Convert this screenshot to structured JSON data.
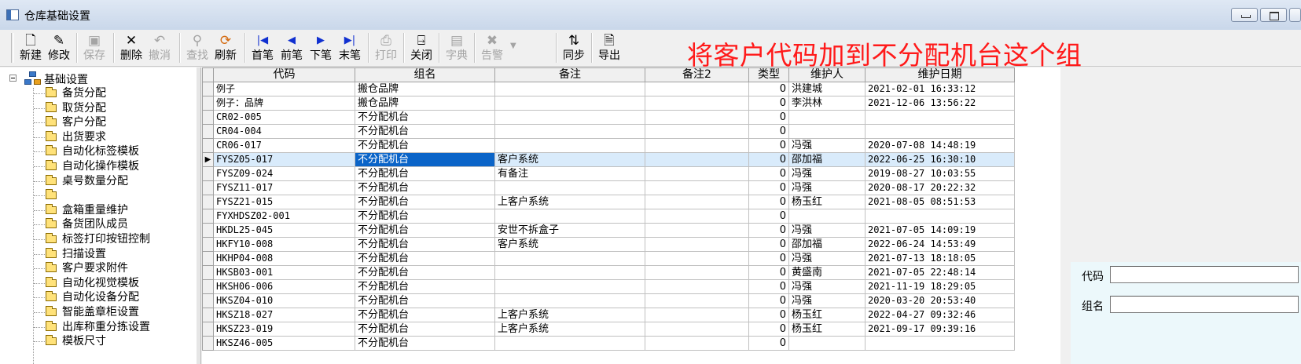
{
  "window": {
    "title": "仓库基础设置"
  },
  "toolbar": {
    "buttons": [
      {
        "label": "新建",
        "icon": "new-document-icon",
        "enabled": true
      },
      {
        "label": "修改",
        "icon": "edit-icon",
        "enabled": true
      },
      {
        "label": "保存",
        "icon": "save-disk-icon",
        "enabled": false
      },
      {
        "label": "删除",
        "icon": "delete-x-icon",
        "enabled": true
      },
      {
        "label": "撤消",
        "icon": "undo-icon",
        "enabled": false
      },
      {
        "label": "查找",
        "icon": "binoculars-icon",
        "enabled": false
      },
      {
        "label": "刷新",
        "icon": "refresh-icon",
        "enabled": true
      },
      {
        "label": "首笔",
        "icon": "first-record-icon",
        "enabled": true
      },
      {
        "label": "前笔",
        "icon": "previous-record-icon",
        "enabled": true
      },
      {
        "label": "下笔",
        "icon": "next-record-icon",
        "enabled": true
      },
      {
        "label": "末笔",
        "icon": "last-record-icon",
        "enabled": true
      },
      {
        "label": "打印",
        "icon": "printer-icon",
        "enabled": false
      },
      {
        "label": "关闭",
        "icon": "close-door-icon",
        "enabled": true
      },
      {
        "label": "字典",
        "icon": "dictionary-icon",
        "enabled": false
      },
      {
        "label": "告警",
        "icon": "alarm-icon",
        "enabled": false
      },
      {
        "label": "同步",
        "icon": "sync-icon",
        "enabled": true
      },
      {
        "label": "导出",
        "icon": "export-icon",
        "enabled": true
      }
    ]
  },
  "annotation": "将客户代码加到不分配机台这个组",
  "tree": {
    "root": "基础设置",
    "items": [
      "备货分配",
      "取货分配",
      "客户分配",
      "出货要求",
      "自动化标签模板",
      "自动化操作模板",
      "桌号数量分配",
      "",
      "盒箱重量维护",
      "备货团队成员",
      "标签打印按钮控制",
      "扫描设置",
      "客户要求附件",
      "自动化视觉模板",
      "自动化设备分配",
      "智能盖章柜设置",
      "出库称重分拣设置",
      "模板尺寸"
    ]
  },
  "grid": {
    "columns": [
      "代码",
      "组名",
      "备注",
      "备注2",
      "类型",
      "维护人",
      "维护日期"
    ],
    "rows": [
      [
        "例子",
        "搬仓品牌",
        "",
        "",
        "0",
        "洪建城",
        "2021-02-01 16:33:12"
      ],
      [
        "例子：品牌",
        "搬仓品牌",
        "",
        "",
        "0",
        "李洪林",
        "2021-12-06 13:56:22"
      ],
      [
        "CR02-005",
        "不分配机台",
        "",
        "",
        "0",
        "",
        ""
      ],
      [
        "CR04-004",
        "不分配机台",
        "",
        "",
        "0",
        "",
        ""
      ],
      [
        "CR06-017",
        "不分配机台",
        "",
        "",
        "0",
        "冯强",
        "2020-07-08 14:48:19"
      ],
      [
        "FYSZ05-017",
        "不分配机台",
        "客户系统",
        "",
        "0",
        "邵加福",
        "2022-06-25 16:30:10"
      ],
      [
        "FYSZ09-024",
        "不分配机台",
        "有备注",
        "",
        "0",
        "冯强",
        "2019-08-27 10:03:55"
      ],
      [
        "FYSZ11-017",
        "不分配机台",
        "",
        "",
        "0",
        "冯强",
        "2020-08-17 20:22:32"
      ],
      [
        "FYSZ21-015",
        "不分配机台",
        "上客户系统",
        "",
        "0",
        "杨玉红",
        "2021-08-05 08:51:53"
      ],
      [
        "FYXHDSZ02-001",
        "不分配机台",
        "",
        "",
        "0",
        "",
        ""
      ],
      [
        "HKDL25-045",
        "不分配机台",
        "安世不拆盒子",
        "",
        "0",
        "冯强",
        "2021-07-05 14:09:19"
      ],
      [
        "HKFY10-008",
        "不分配机台",
        "客户系统",
        "",
        "0",
        "邵加福",
        "2022-06-24 14:53:49"
      ],
      [
        "HKHP04-008",
        "不分配机台",
        "",
        "",
        "0",
        "冯强",
        "2021-07-13 18:18:05"
      ],
      [
        "HKSB03-001",
        "不分配机台",
        "",
        "",
        "0",
        "黄盛南",
        "2021-07-05 22:48:14"
      ],
      [
        "HKSH06-006",
        "不分配机台",
        "",
        "",
        "0",
        "冯强",
        "2021-11-19 18:29:05"
      ],
      [
        "HKSZ04-010",
        "不分配机台",
        "",
        "",
        "0",
        "冯强",
        "2020-03-20 20:53:40"
      ],
      [
        "HKSZ18-027",
        "不分配机台",
        "上客户系统",
        "",
        "0",
        "杨玉红",
        "2022-04-27 09:32:46"
      ],
      [
        "HKSZ23-019",
        "不分配机台",
        "上客户系统",
        "",
        "0",
        "杨玉红",
        "2021-09-17 09:39:16"
      ],
      [
        "HKSZ46-005",
        "不分配机台",
        "",
        "",
        "0",
        "",
        ""
      ]
    ],
    "selected_row": 5
  },
  "form": {
    "code_label": "代码",
    "group_label": "组名",
    "code_value": "",
    "group_value": ""
  }
}
